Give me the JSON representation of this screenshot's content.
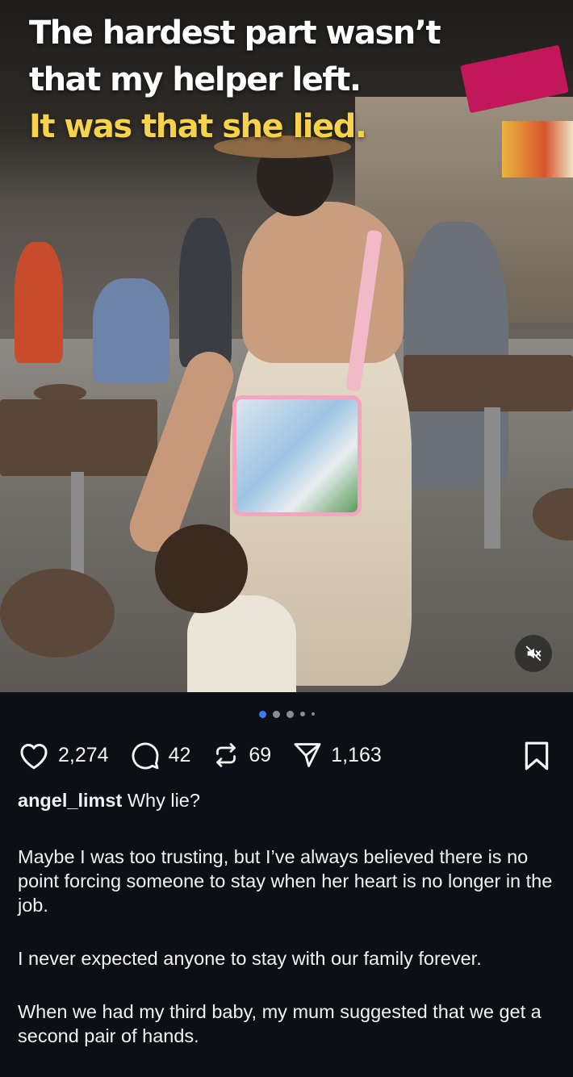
{
  "post": {
    "headline_line1": "The hardest part wasn’t",
    "headline_line2": "that my helper left.",
    "headline_line3": "It was that she lied.",
    "headline_color": "#f9d24c",
    "carousel": {
      "total_dots": 5,
      "active_index": 0
    },
    "mute_icon": "speaker-muted-icon"
  },
  "actions": {
    "likes": "2,274",
    "comments": "42",
    "reposts": "69",
    "shares": "1,163"
  },
  "caption": {
    "username": "angel_limst",
    "first_line": "Why lie?",
    "paragraphs": [
      "Maybe I was too trusting, but I’ve always believed there is no point forcing someone to stay when her heart is no longer in the job.",
      "I never expected anyone to stay with our family forever.",
      "When we had my third baby, my mum suggested that we get a second pair of hands."
    ]
  },
  "colors": {
    "background": "#0c1014",
    "active_dot": "#3d7bff",
    "text": "#f5f5f5"
  }
}
